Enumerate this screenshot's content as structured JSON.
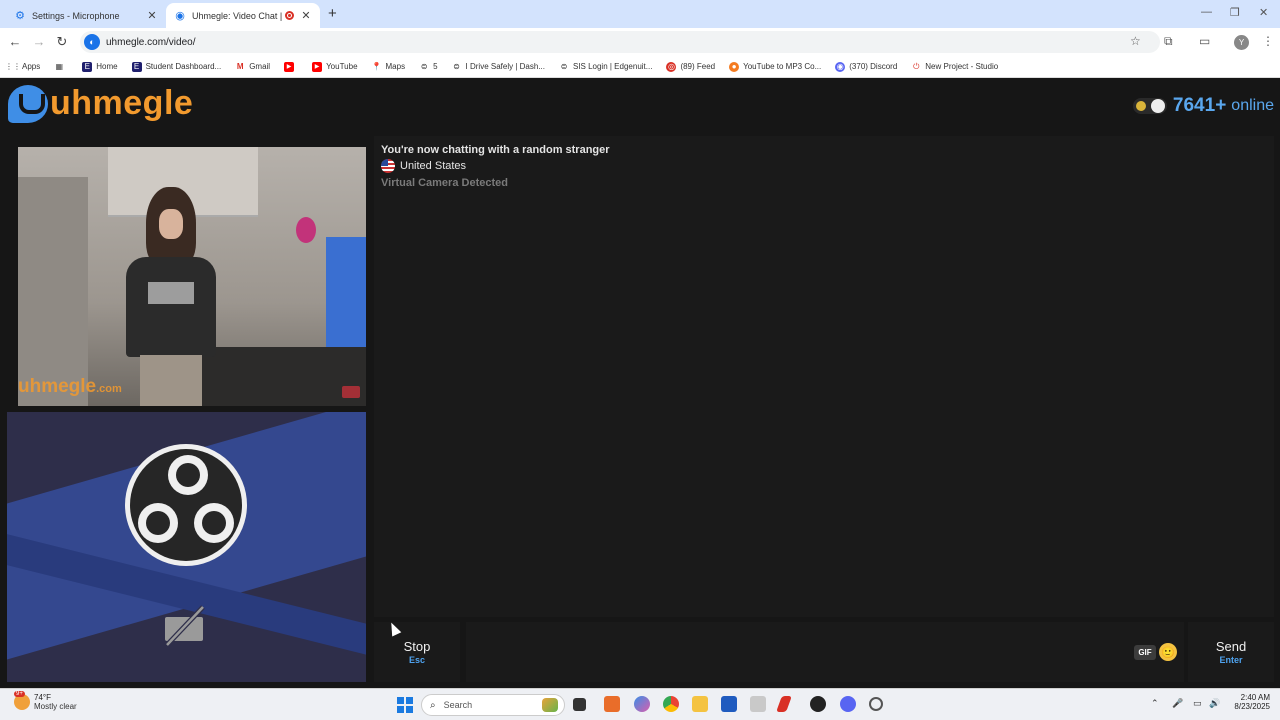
{
  "browser": {
    "tabs": [
      {
        "title": "Settings - Microphone",
        "icon": "gear-icon"
      },
      {
        "title": "Uhmegle: Video Chat | Om",
        "icon": "uhmegle-icon"
      }
    ],
    "url": "uhmegle.com/video/",
    "profile_initial": "Y",
    "bookmarks": [
      {
        "label": "Apps",
        "icon": "apps-grid-icon"
      },
      {
        "label": "",
        "icon": "tab-groups-icon"
      },
      {
        "label": "Home",
        "icon": "edgenuity-icon"
      },
      {
        "label": "Student Dashboard...",
        "icon": "edgenuity-icon"
      },
      {
        "label": "Gmail",
        "icon": "gmail-icon"
      },
      {
        "label": "",
        "icon": "youtube-icon"
      },
      {
        "label": "YouTube",
        "icon": "youtube-icon"
      },
      {
        "label": "Maps",
        "icon": "maps-icon"
      },
      {
        "label": "5",
        "icon": "globe-icon"
      },
      {
        "label": "I Drive Safely | Dash...",
        "icon": "globe-icon"
      },
      {
        "label": "SIS Login | Edgenuit...",
        "icon": "globe-icon"
      },
      {
        "label": "(89) Feed",
        "icon": "feed-icon"
      },
      {
        "label": "YouTube to MP3 Co...",
        "icon": "firefox-icon"
      },
      {
        "label": "(370) Discord",
        "icon": "discord-icon"
      },
      {
        "label": "New Project - Studio",
        "icon": "studio-icon"
      }
    ]
  },
  "site": {
    "logo_text": "uhmegle",
    "online_count": "7641",
    "online_plus": "+",
    "online_label": "online",
    "watermark": "uhmegle",
    "watermark_suffix": ".com",
    "chat_messages": {
      "intro": "You're now chatting with a random stranger",
      "country": "United States",
      "notice": "Virtual Camera Detected"
    },
    "stop_button": {
      "label": "Stop",
      "key": "Esc"
    },
    "send_button": {
      "label": "Send",
      "key": "Enter"
    },
    "gif_label": "GIF",
    "emoji": "🙂"
  },
  "taskbar": {
    "weather_temp": "74°F",
    "weather_cond": "Mostly clear",
    "weather_badge": "9+",
    "search_label": "Search",
    "time": "2:40 AM",
    "date": "8/23/2025"
  }
}
